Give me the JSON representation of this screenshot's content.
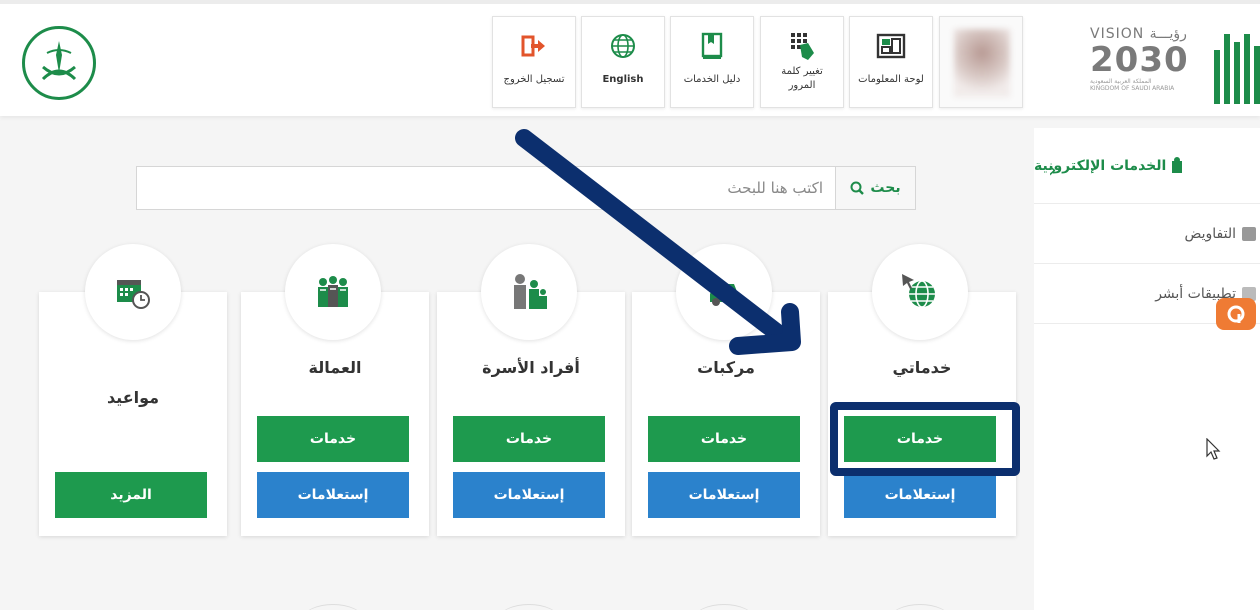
{
  "header": {
    "tiles": [
      {
        "id": "logout",
        "label": "تسجيل الخروج",
        "icon": "logout-icon"
      },
      {
        "id": "language",
        "label": "English",
        "icon": "globe-icon"
      },
      {
        "id": "services-guide",
        "label": "دليل الخدمات",
        "icon": "book-icon"
      },
      {
        "id": "change-password",
        "label_line1": "تغيير كلمة",
        "label_line2": "المرور",
        "icon": "keypad-icon"
      },
      {
        "id": "dashboard",
        "label": "لوحة المعلومات",
        "icon": "dashboard-icon"
      }
    ],
    "vision": {
      "top_en": "VISION",
      "top_ar": "رؤيـــة",
      "year": "2030",
      "sub_ar": "المملكة العربية السعودية",
      "sub_en": "KINGDOM OF SAUDI ARABIA"
    }
  },
  "sidebar": {
    "title": "الخدمات الإلكترونية",
    "items": [
      {
        "label": "التفاويض"
      },
      {
        "label": "تطبيقات أبشر"
      }
    ]
  },
  "search": {
    "button_label": "بحث",
    "placeholder": "اكتب هنا للبحث"
  },
  "cards": [
    {
      "id": "my-services",
      "title": "خدماتي",
      "primary": "خدمات",
      "secondary": "إستعلامات",
      "icon": "globe-cursor-icon"
    },
    {
      "id": "vehicles",
      "title": "مركبات",
      "primary": "خدمات",
      "secondary": "إستعلامات",
      "icon": "car-icon"
    },
    {
      "id": "family",
      "title": "أفراد الأسرة",
      "primary": "خدمات",
      "secondary": "إستعلامات",
      "icon": "family-icon"
    },
    {
      "id": "labor",
      "title": "العمالة",
      "primary": "خدمات",
      "secondary": "إستعلامات",
      "icon": "workers-icon"
    },
    {
      "id": "appointments",
      "title": "مواعيد",
      "primary": "المزيد",
      "icon": "calendar-clock-icon"
    }
  ],
  "colors": {
    "green": "#1e9a4e",
    "blue": "#2b82cc",
    "annotation": "#0c2f6e",
    "orange_badge": "#ef7b34"
  }
}
